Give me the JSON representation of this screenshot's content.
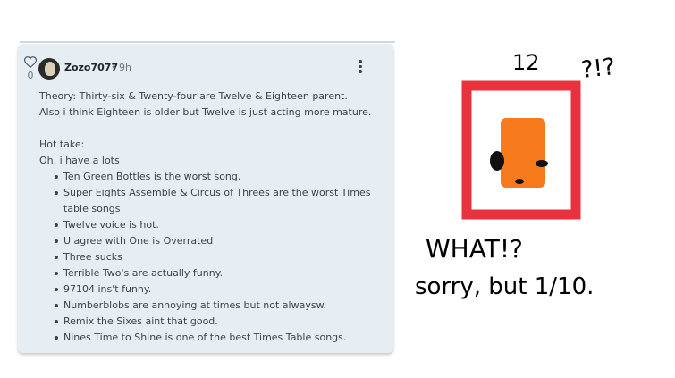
{
  "post": {
    "like_count": "0",
    "username": "Zozo7077",
    "separator": "•",
    "time": "9h",
    "lines": [
      "Theory: Thirty-six & Twenty-four are Twelve & Eighteen parent.",
      "Also i think Eighteen is older but Twelve is just acting more mature."
    ],
    "hot_take_heading": "Hot take:",
    "hot_take_intro": "Oh, i have a lots",
    "list": [
      "Ten Green Bottles is the worst song.",
      "Super Eights Assemble & Circus of Threes are the worst Times table songs",
      "Twelve voice is hot.",
      "U agree with One is Overrated",
      "Three sucks",
      "Terrible Two's are actually funny.",
      "97104 ins't funny.",
      "Numberblobs are annoying at times but not alwaysw.",
      "Remix the Sixes aint that good.",
      "Nines Time to Shine is one of the best Times Table songs."
    ]
  },
  "drawing": {
    "label_number": "12",
    "label_exclaim": "?!?",
    "text_what": "WHAT!?",
    "text_rating": "sorry, but 1/10.",
    "frame_color": "#e8333f",
    "block_color": "#f77a1c"
  }
}
